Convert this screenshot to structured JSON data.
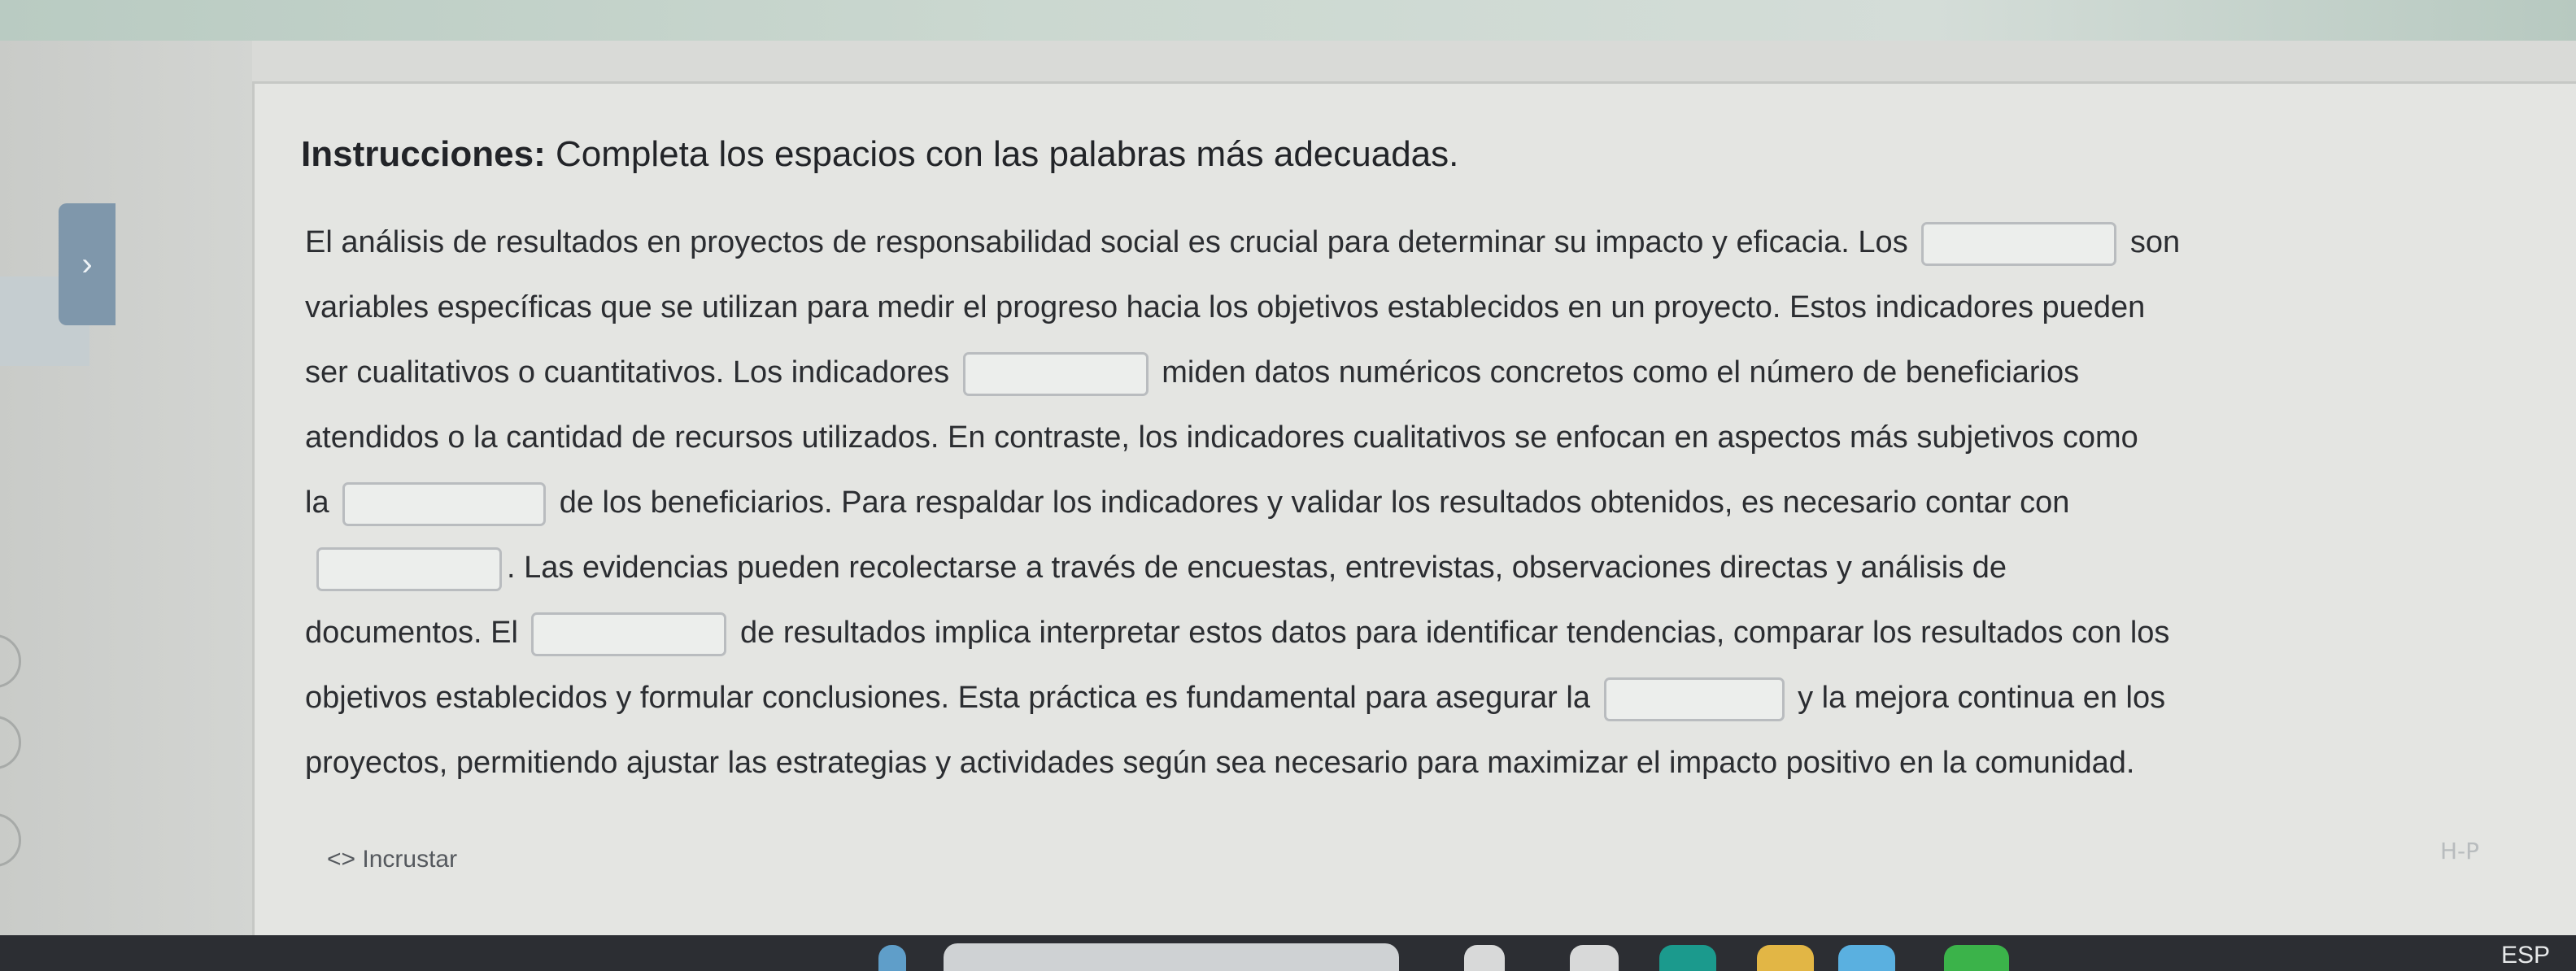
{
  "instructions": {
    "bold": "Instrucciones:",
    "text": " Completa los espacios con las palabras más adecuadas."
  },
  "paragraph": {
    "l1a": "El análisis de resultados en proyectos de responsabilidad social es crucial para determinar su impacto y eficacia. Los",
    "l1b": "son",
    "l2": "variables específicas que se utilizan para medir el progreso hacia los objetivos establecidos en un proyecto. Estos indicadores pueden",
    "l3a": "ser cualitativos o cuantitativos. Los indicadores",
    "l3b": "miden datos numéricos concretos como el número de beneficiarios",
    "l4": "atendidos o la cantidad de recursos utilizados. En contraste, los indicadores cualitativos se enfocan en aspectos más subjetivos como",
    "l5a": "la",
    "l5b": "de los beneficiarios. Para respaldar los indicadores y validar los resultados obtenidos, es necesario contar con",
    "l6": ". Las evidencias pueden recolectarse a través de encuestas, entrevistas, observaciones directas y análisis de",
    "l7a": "documentos. El",
    "l7b": "de resultados implica interpretar estos datos para identificar tendencias, comparar los resultados con los",
    "l8a": "objetivos establecidos y formular conclusiones. Esta práctica es fundamental para asegurar la",
    "l8b": "y la mejora continua en los",
    "l9": "proyectos, permitiendo ajustar las estrategias y actividades según sea necesario para maximizar el impacto positivo en la comunidad."
  },
  "embed": {
    "icon": "<>",
    "label": "Incrustar"
  },
  "watermark": "H-P",
  "taskbar": {
    "language": "ESP"
  },
  "colors": {
    "page_bg": "#e4e5e2",
    "blank_border": "#b9bcbf",
    "side_toggle": "#7f97ab",
    "taskbar": "#2c2e33"
  }
}
